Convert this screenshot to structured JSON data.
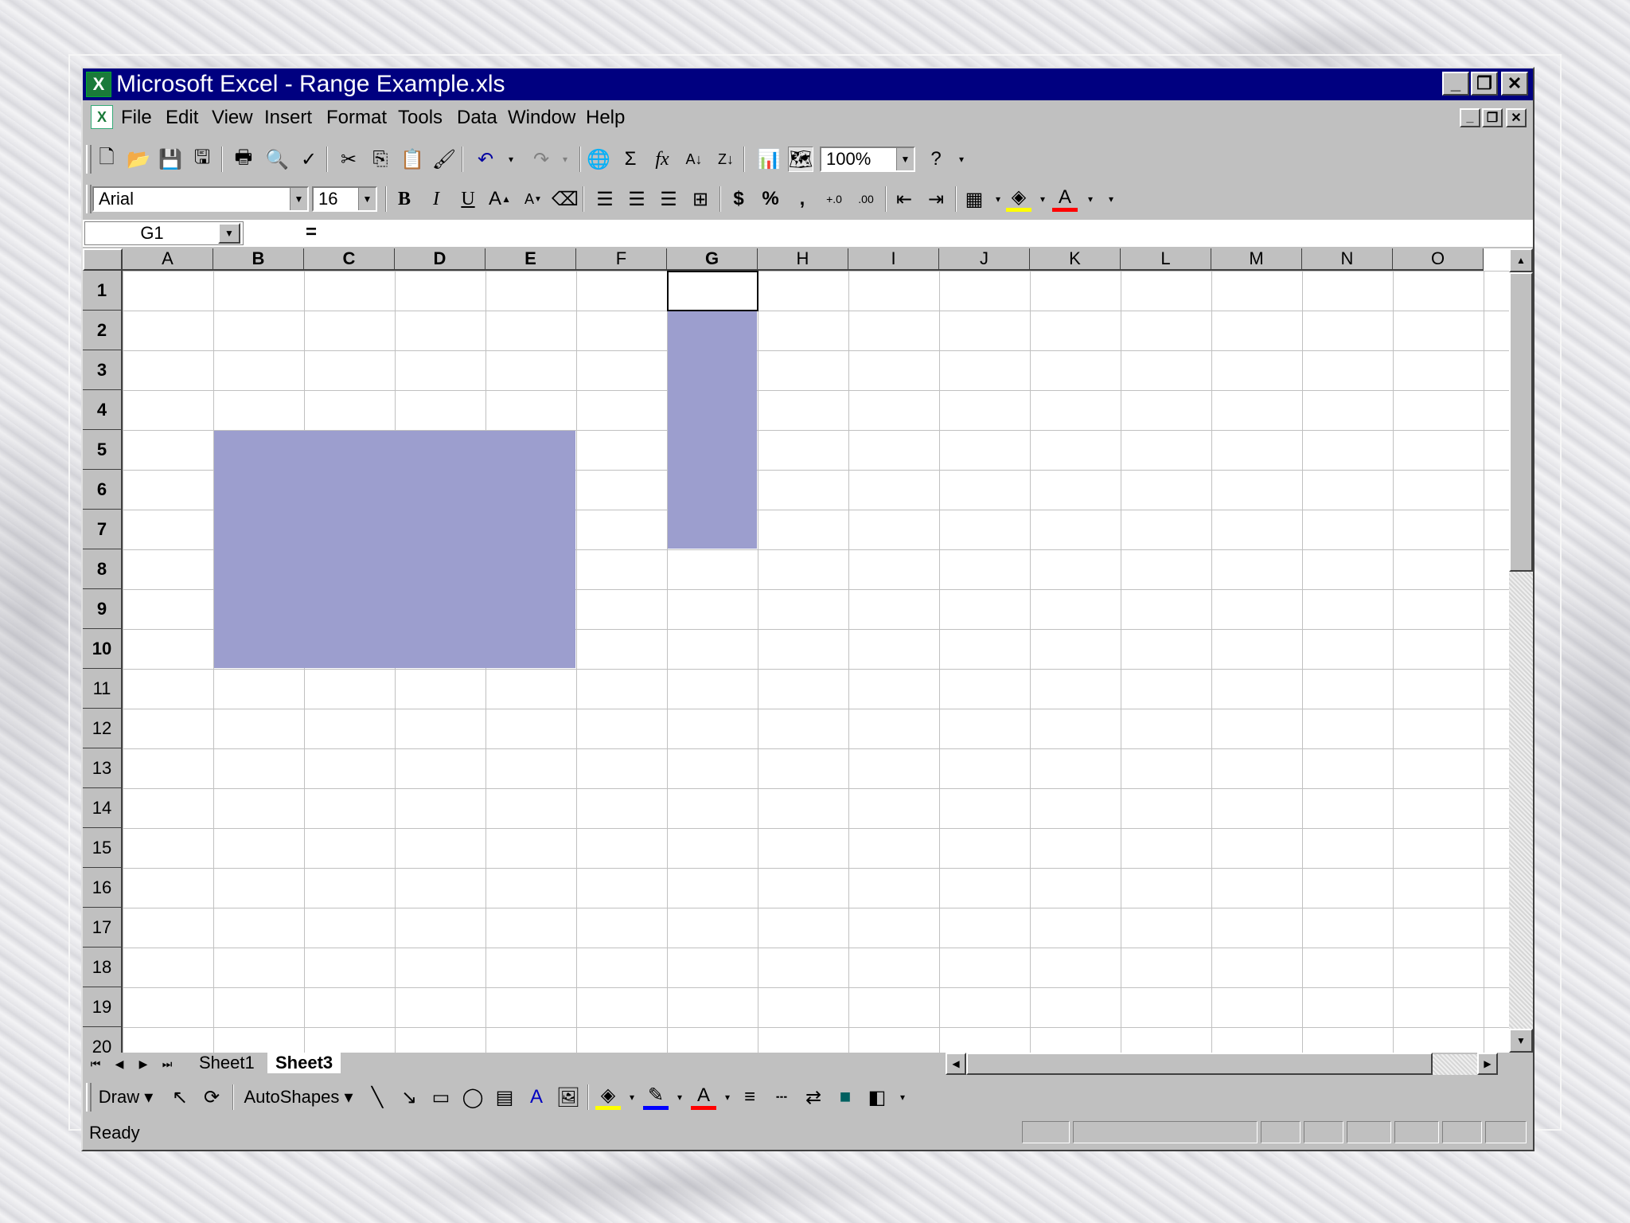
{
  "window": {
    "title": "Microsoft Excel - Range Example.xls",
    "controls": [
      "minimize",
      "restore",
      "close"
    ]
  },
  "menubar": {
    "items": [
      {
        "label": "File"
      },
      {
        "label": "Edit"
      },
      {
        "label": "View"
      },
      {
        "label": "Insert"
      },
      {
        "label": "Format"
      },
      {
        "label": "Tools"
      },
      {
        "label": "Data"
      },
      {
        "label": "Window"
      },
      {
        "label": "Help"
      }
    ]
  },
  "standard_toolbar": {
    "zoom": "100%",
    "icons": [
      "new-icon",
      "open-icon",
      "save-icon",
      "save-as-icon",
      "print-icon",
      "print-preview-icon",
      "spelling-icon",
      "cut-icon",
      "copy-icon",
      "paste-icon",
      "format-painter-icon",
      "undo-icon",
      "redo-icon",
      "hyperlink-icon",
      "autosum-icon",
      "function-icon",
      "sort-ascending-icon",
      "sort-descending-icon",
      "chart-wizard-icon",
      "map-icon",
      "help-icon"
    ]
  },
  "formatting_toolbar": {
    "font": "Arial",
    "size": "16",
    "bold": "B",
    "italic": "I",
    "underline": "U",
    "currency": "$",
    "percent": "%",
    "comma": ","
  },
  "formula_bar": {
    "name_box": "G1",
    "equals": "=",
    "content": ""
  },
  "sheet": {
    "columns": [
      "A",
      "B",
      "C",
      "D",
      "E",
      "F",
      "G",
      "H",
      "I",
      "J",
      "K",
      "L",
      "M",
      "N",
      "O"
    ],
    "rows": [
      "1",
      "2",
      "3",
      "4",
      "5",
      "6",
      "7",
      "8",
      "9",
      "10",
      "11",
      "12",
      "13",
      "14",
      "15",
      "16",
      "17",
      "18",
      "19",
      "20"
    ],
    "active_cell": "G1",
    "selected_ranges": [
      "B5:E10",
      "G1:G7"
    ],
    "selection_color": "#9c9ece"
  },
  "tabs": {
    "sheets": [
      {
        "label": "Sheet1",
        "active": false
      },
      {
        "label": "Sheet3",
        "active": true
      }
    ]
  },
  "drawing_toolbar": {
    "draw": "Draw",
    "autoshapes": "AutoShapes"
  },
  "status": {
    "text": "Ready"
  }
}
